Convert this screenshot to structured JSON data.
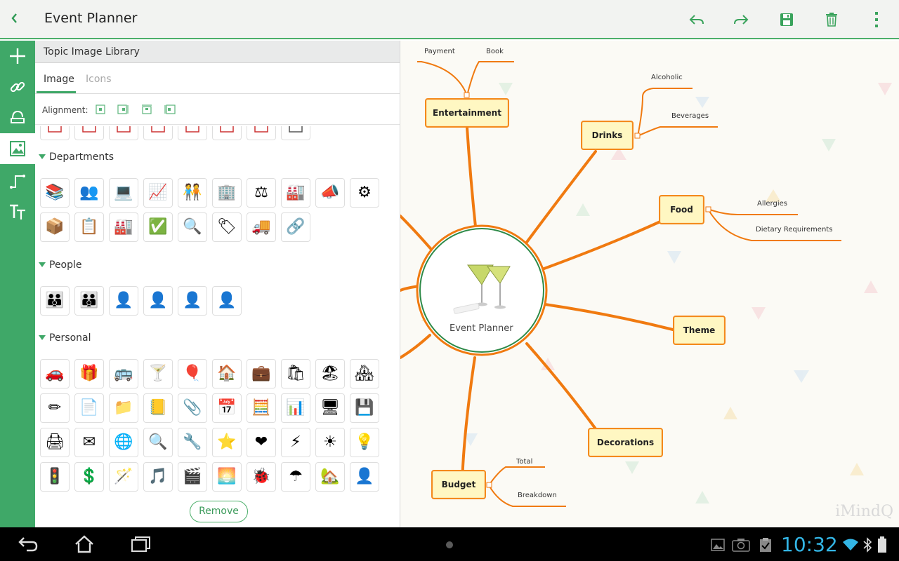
{
  "app": {
    "title": "Event Planner",
    "watermark": "iMindQ"
  },
  "colors": {
    "accent": "#3fa868",
    "topic_border": "#f48a1c",
    "topic_fill": "#fff7c2",
    "clock": "#33b5e5"
  },
  "toolbar": {
    "back_icon": "chevron-left-icon",
    "actions": [
      "undo-icon",
      "redo-icon",
      "save-icon",
      "delete-icon",
      "overflow-menu-icon"
    ]
  },
  "rail": {
    "tools": [
      "add-icon",
      "link-icon",
      "relationship-icon",
      "image-icon",
      "connector-icon",
      "text-format-icon"
    ],
    "active": "image-icon"
  },
  "library": {
    "header": "Topic Image Library",
    "tabs": [
      "Image",
      "Icons"
    ],
    "active_tab": "Image",
    "alignment_label": "Alignment:",
    "sections": [
      {
        "title": "Departments",
        "icons": [
          "📚",
          "👥",
          "💻",
          "📈",
          "🧑‍🤝‍🧑",
          "🏢",
          "⚖",
          "🏭",
          "📣",
          "⚙",
          "📦",
          "📋",
          "🏭",
          "✅",
          "🔍",
          "🏷",
          "🚚",
          "🔗"
        ]
      },
      {
        "title": "People",
        "icons": [
          "👪",
          "👪",
          "👤",
          "👤",
          "👤",
          "👤"
        ]
      },
      {
        "title": "Personal",
        "icons": [
          "🚗",
          "🎁",
          "🚌",
          "🍸",
          "🎈",
          "🏠",
          "💼",
          "🛍",
          "🏖",
          "🏘",
          "✏",
          "📄",
          "📁",
          "📒",
          "📎",
          "📅",
          "🧮",
          "📊",
          "🖥",
          "💾",
          "🖨",
          "✉",
          "🌐",
          "🔍",
          "🔧",
          "⭐",
          "❤",
          "⚡",
          "☀",
          "💡",
          "🚦",
          "💲",
          "🪄",
          "🎵",
          "🎬",
          "🌅",
          "🐞",
          "☂",
          "🏡",
          "👤"
        ]
      }
    ],
    "remove_label": "Remove"
  },
  "mindmap": {
    "central_topic": "Event Planner",
    "topics": {
      "entertainment": {
        "label": "Entertainment",
        "subtopics": [
          "Payment",
          "Book"
        ]
      },
      "drinks": {
        "label": "Drinks",
        "subtopics": [
          "Alcoholic",
          "Beverages"
        ]
      },
      "food": {
        "label": "Food",
        "subtopics": [
          "Allergies",
          "Dietary Requirements"
        ]
      },
      "theme": {
        "label": "Theme"
      },
      "decorations": {
        "label": "Decorations"
      },
      "budget": {
        "label": "Budget",
        "subtopics": [
          "Total",
          "Breakdown"
        ]
      }
    }
  },
  "system": {
    "clock": "10:32"
  }
}
